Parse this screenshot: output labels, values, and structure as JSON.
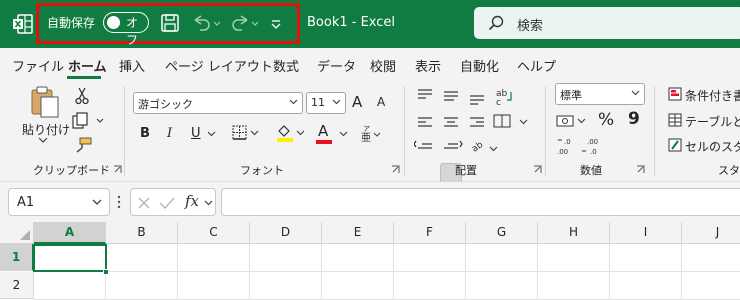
{
  "titlebar": {
    "autosave_label": "自動保存",
    "autosave_state": "オフ",
    "document_title": "Book1  -  Excel",
    "search_placeholder": "検索",
    "brand_color": "#107c41",
    "highlight_color": "#e01010"
  },
  "tabs": [
    "ファイル",
    "ホーム",
    "挿入",
    "ページ レイアウト",
    "数式",
    "データ",
    "校閲",
    "表示",
    "自動化",
    "ヘルプ"
  ],
  "active_tab": "ホーム",
  "ribbon": {
    "clipboard": {
      "paste_label": "貼り付け",
      "group_label": "クリップボード"
    },
    "font": {
      "font_name": "游ゴシック",
      "font_size": "11",
      "bold": "B",
      "italic": "I",
      "underline": "U",
      "font_color_glyph": "A",
      "grow_glyph": "A",
      "shrink_glyph": "A",
      "group_label": "フォント"
    },
    "alignment": {
      "group_label": "配置"
    },
    "number": {
      "format": "標準",
      "percent": "%",
      "comma": "9",
      "group_label": "数値"
    },
    "styles": {
      "conditional": "条件付き書",
      "table": "テーブルとし",
      "cell": "セルのスタイ",
      "group_label": "スタ"
    }
  },
  "formula_bar": {
    "name_box": "A1",
    "fx": "fx",
    "formula": ""
  },
  "grid": {
    "columns": [
      "A",
      "B",
      "C",
      "D",
      "E",
      "F",
      "G",
      "H",
      "I",
      "J"
    ],
    "rows": [
      "1",
      "2"
    ],
    "active_cell": "A1"
  }
}
